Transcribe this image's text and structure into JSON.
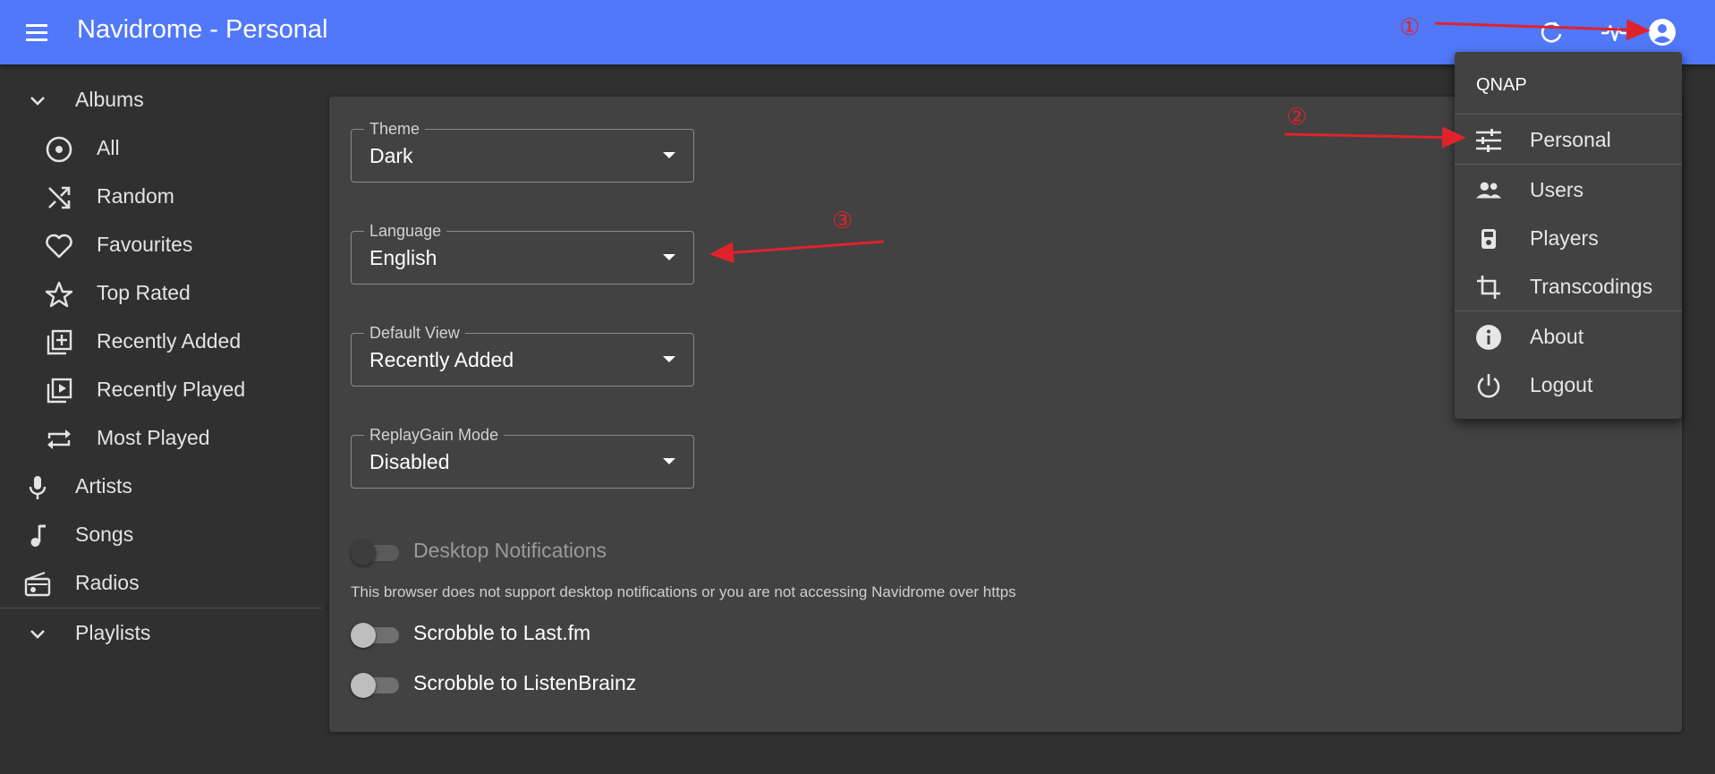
{
  "app": {
    "title": "Navidrome - Personal"
  },
  "appbar_icons": [
    "menu-icon",
    "refresh-icon",
    "activity-icon",
    "account-circle-icon"
  ],
  "sidebar": {
    "albums": {
      "label": "Albums",
      "items": [
        {
          "label": "All",
          "icon": "album-icon"
        },
        {
          "label": "Random",
          "icon": "shuffle-icon"
        },
        {
          "label": "Favourites",
          "icon": "heart-icon"
        },
        {
          "label": "Top Rated",
          "icon": "star-icon"
        },
        {
          "label": "Recently Added",
          "icon": "library-add-icon"
        },
        {
          "label": "Recently Played",
          "icon": "video-library-icon"
        },
        {
          "label": "Most Played",
          "icon": "repeat-icon"
        }
      ]
    },
    "artists": {
      "label": "Artists",
      "icon": "mic-icon"
    },
    "songs": {
      "label": "Songs",
      "icon": "music-note-icon"
    },
    "radios": {
      "label": "Radios",
      "icon": "radio-icon"
    },
    "playlists": {
      "label": "Playlists"
    }
  },
  "settings": {
    "theme": {
      "label": "Theme",
      "value": "Dark"
    },
    "language": {
      "label": "Language",
      "value": "English"
    },
    "default_view": {
      "label": "Default View",
      "value": "Recently Added"
    },
    "replaygain": {
      "label": "ReplayGain Mode",
      "value": "Disabled"
    },
    "desktop_notifications": {
      "label": "Desktop Notifications",
      "enabled": false,
      "disabled": true
    },
    "notifications_helper": "This browser does not support desktop notifications or you are not accessing Navidrome over https",
    "scrobble_lastfm": {
      "label": "Scrobble to Last.fm",
      "enabled": false
    },
    "scrobble_listenbrainz": {
      "label": "Scrobble to ListenBrainz",
      "enabled": false
    }
  },
  "user_menu": {
    "username": "QNAP",
    "items": [
      {
        "label": "Personal",
        "icon": "tune-icon"
      },
      {
        "label": "Users",
        "icon": "people-icon"
      },
      {
        "label": "Players",
        "icon": "player-icon"
      },
      {
        "label": "Transcodings",
        "icon": "crop-icon"
      },
      {
        "label": "About",
        "icon": "info-icon"
      },
      {
        "label": "Logout",
        "icon": "power-icon"
      }
    ]
  },
  "annotations": {
    "step1": "①",
    "step2": "②",
    "step3": "③",
    "color": "#e0232b"
  },
  "colors": {
    "appbar": "#5078f9",
    "background": "#303030",
    "card": "#424242"
  }
}
